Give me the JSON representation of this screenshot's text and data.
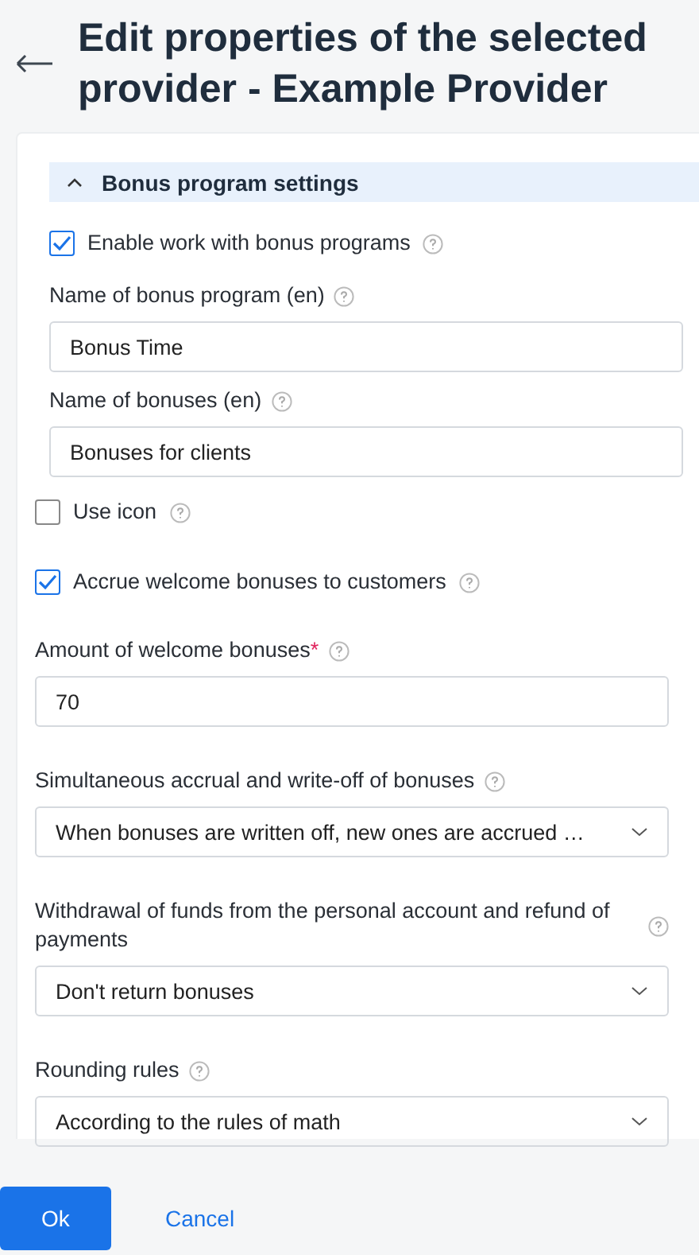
{
  "header": {
    "title": "Edit properties of the selected provider - Example Provider"
  },
  "section": {
    "title": "Bonus program settings",
    "expanded": true,
    "items": [
      {
        "kind": "checkbox",
        "label": "Enable work with bonus programs",
        "checked": true,
        "help": true
      },
      {
        "kind": "text",
        "label": "Name of bonus program (en)",
        "value": "Bonus Time",
        "help": true
      },
      {
        "kind": "text",
        "label": "Name of bonuses (en)",
        "value": "Bonuses for clients",
        "help": true
      }
    ]
  },
  "fields": [
    {
      "kind": "checkbox",
      "label": "Use icon",
      "checked": false,
      "help": true
    },
    {
      "kind": "checkbox",
      "label": "Accrue welcome bonuses to customers",
      "checked": true,
      "help": true
    },
    {
      "kind": "text",
      "label": "Amount of welcome bonuses",
      "required_mark": "*",
      "value": "70",
      "help": true
    },
    {
      "kind": "select",
      "label": "Simultaneous accrual and write-off of bonuses",
      "value": "When bonuses are written off, new ones are accrued …",
      "help": true
    },
    {
      "kind": "select",
      "label": "Withdrawal of funds from the personal account and refund of payments",
      "value": "Don't return bonuses",
      "help": true
    },
    {
      "kind": "select",
      "label": "Rounding rules",
      "value": "According to the rules of math",
      "help": true
    }
  ],
  "buttons": [
    {
      "kind": "primary",
      "label": "Ok"
    },
    {
      "kind": "link",
      "label": "Cancel"
    }
  ]
}
